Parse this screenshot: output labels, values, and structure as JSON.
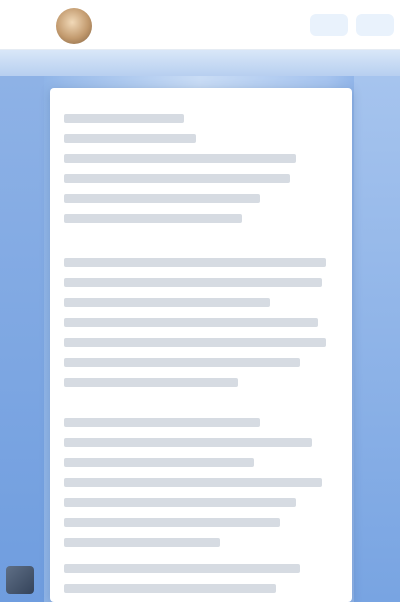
{
  "header": {
    "title": "",
    "actions": [
      {
        "label": ""
      },
      {
        "label": ""
      }
    ]
  },
  "paragraphs": [
    {
      "lines": [
        "",
        "",
        "",
        "",
        "",
        ""
      ]
    },
    {
      "lines": [
        "",
        "",
        "",
        "",
        "",
        "",
        ""
      ]
    },
    {
      "lines": [
        "",
        "",
        "",
        "",
        "",
        "",
        ""
      ]
    },
    {
      "lines": [
        "",
        ""
      ]
    }
  ],
  "colors": {
    "header_bg": "#ffffff",
    "page_bg_edge": "#6f9ddf",
    "page_bg_center": "#c9dcf5",
    "card_bg": "#ffffff",
    "text_placeholder": "#d6dbe2"
  }
}
